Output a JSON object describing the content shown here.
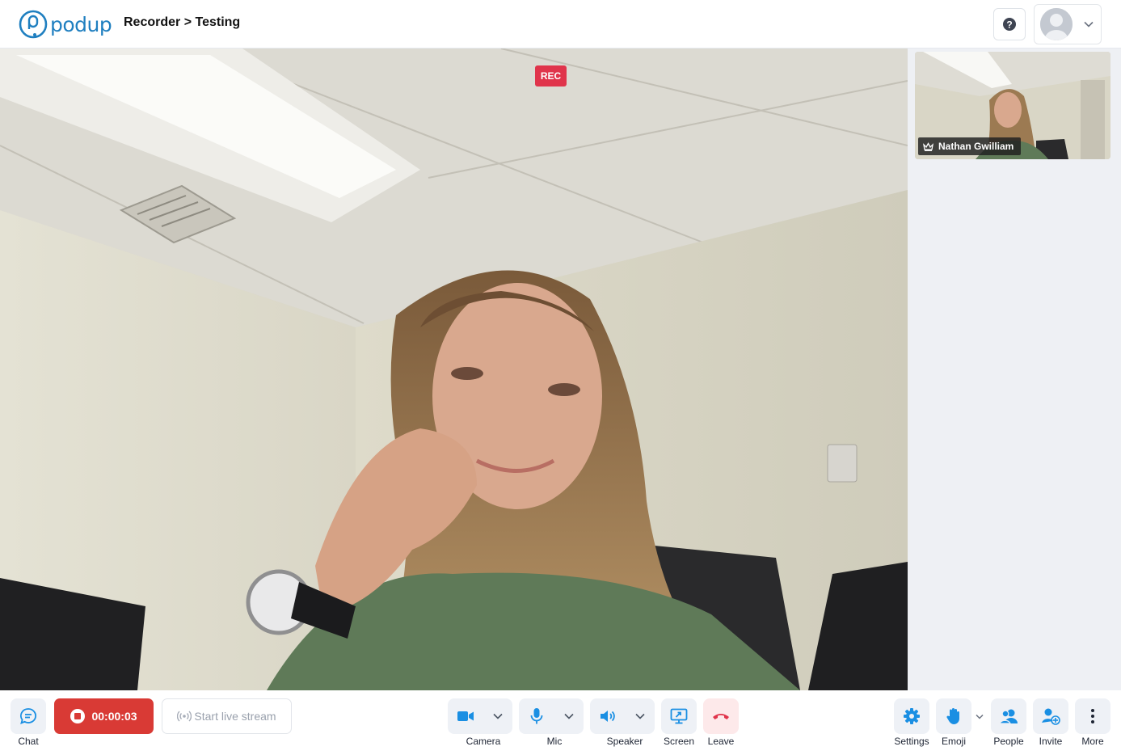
{
  "header": {
    "logo_text": "podup",
    "breadcrumb": "Recorder > Testing",
    "help_icon": "question-icon",
    "account_icon": "avatar-placeholder-icon"
  },
  "stage": {
    "rec_badge": "REC",
    "participant": {
      "name": "Nathan Gwilliam",
      "role_icon": "crown-icon"
    }
  },
  "toolbar": {
    "chat_label": "Chat",
    "timer": "00:00:03",
    "live_label": "Start live stream",
    "camera_label": "Camera",
    "mic_label": "Mic",
    "speaker_label": "Speaker",
    "screen_label": "Screen",
    "leave_label": "Leave",
    "settings_label": "Settings",
    "emoji_label": "Emoji",
    "people_label": "People",
    "invite_label": "Invite",
    "more_label": "More"
  },
  "colors": {
    "brand_blue": "#1f7fc0",
    "record_red": "#d93a35",
    "rec_badge_red": "#e0344b",
    "icon_blue": "#1a8fe3",
    "leave_red": "#e0344b",
    "button_bg": "#eef1f6"
  }
}
